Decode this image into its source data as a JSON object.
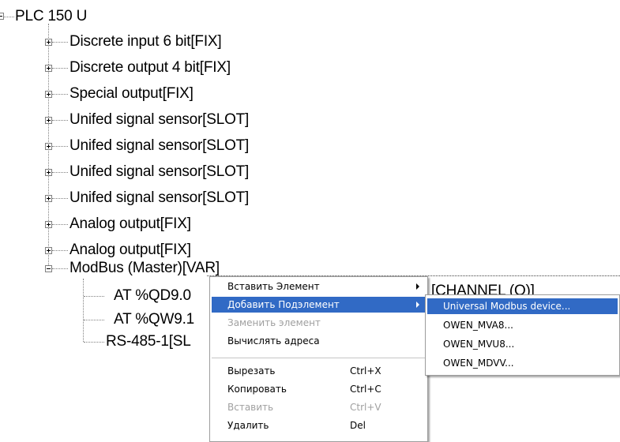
{
  "tree": {
    "root": {
      "label": "PLC 150 U"
    },
    "children": [
      {
        "label": "Discrete input 6 bit[FIX]"
      },
      {
        "label": "Discrete output 4 bit[FIX]"
      },
      {
        "label": "Special output[FIX]"
      },
      {
        "label": "Unifed signal sensor[SLOT]"
      },
      {
        "label": "Unifed signal sensor[SLOT]"
      },
      {
        "label": "Unifed signal sensor[SLOT]"
      },
      {
        "label": "Unifed signal sensor[SLOT]"
      },
      {
        "label": "Analog output[FIX]"
      },
      {
        "label": "Analog output[FIX]"
      },
      {
        "label": "ModBus (Master)[VAR]"
      }
    ],
    "modbus_children": [
      {
        "label": "AT %QD9.0"
      },
      {
        "label": "AT %QW9.1"
      },
      {
        "label": "RS-485-1[SL"
      }
    ],
    "partial_right_label": "[CHANNEL (O)]"
  },
  "context_menu": {
    "items": [
      {
        "label": "Вставить Элемент",
        "shortcut": "",
        "submenu": true,
        "disabled": false,
        "selected": false
      },
      {
        "label": "Добавить Подэлемент",
        "shortcut": "",
        "submenu": true,
        "disabled": false,
        "selected": true
      },
      {
        "label": "Заменить элемент",
        "shortcut": "",
        "submenu": false,
        "disabled": true,
        "selected": false
      },
      {
        "label": "Вычислять адреса",
        "shortcut": "",
        "submenu": false,
        "disabled": false,
        "selected": false
      },
      {
        "label": "Вырезать",
        "shortcut": "Ctrl+X",
        "submenu": false,
        "disabled": false,
        "selected": false
      },
      {
        "label": "Копировать",
        "shortcut": "Ctrl+C",
        "submenu": false,
        "disabled": false,
        "selected": false
      },
      {
        "label": "Вставить",
        "shortcut": "Ctrl+V",
        "submenu": false,
        "disabled": true,
        "selected": false
      },
      {
        "label": "Удалить",
        "shortcut": "Del",
        "submenu": false,
        "disabled": false,
        "selected": false
      }
    ]
  },
  "submenu": {
    "items": [
      {
        "label": "Universal Modbus device...",
        "selected": true
      },
      {
        "label": "OWEN_MVA8...",
        "selected": false
      },
      {
        "label": "OWEN_MVU8...",
        "selected": false
      },
      {
        "label": "OWEN_MDVV...",
        "selected": false
      }
    ]
  },
  "colors": {
    "highlight": "#316ac5",
    "disabled_text": "#a0a0a0",
    "tree_lines": "#808080"
  }
}
